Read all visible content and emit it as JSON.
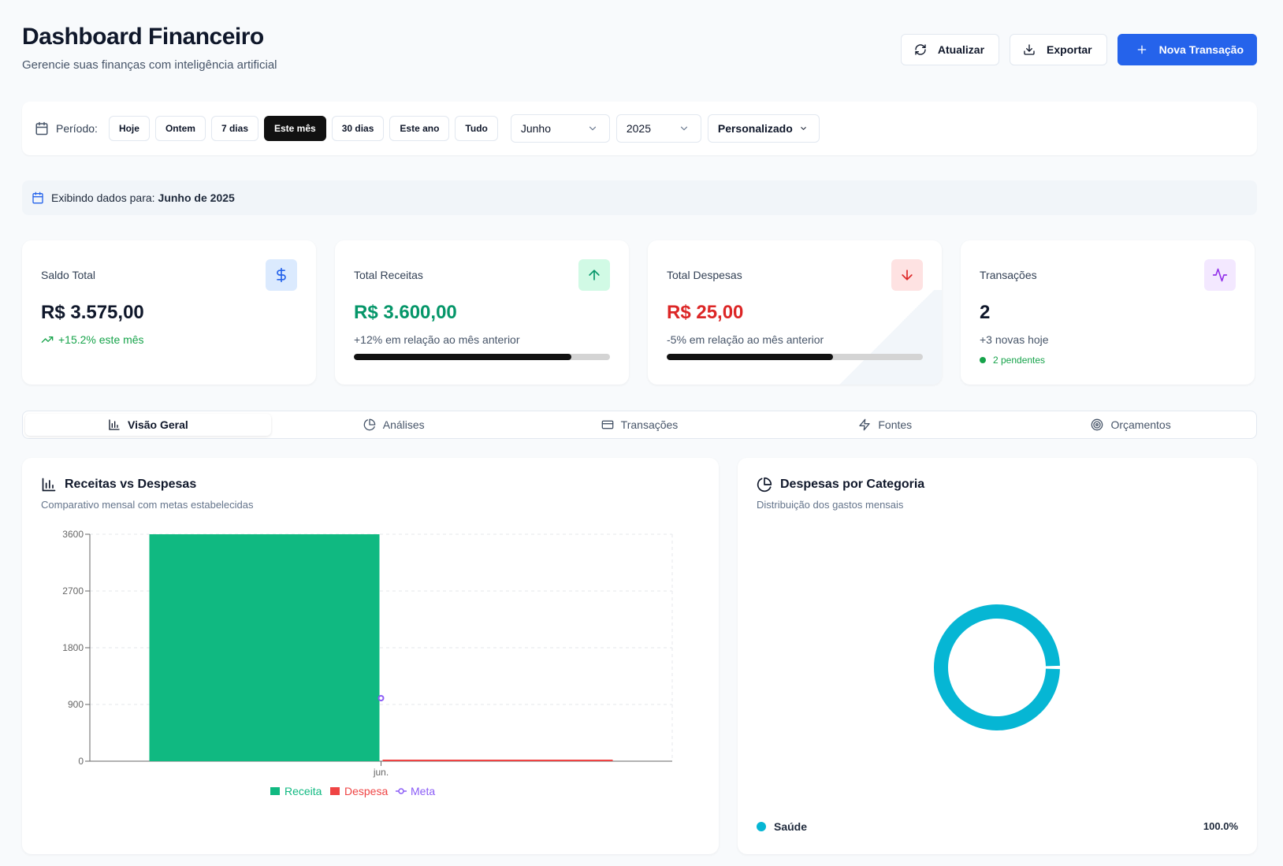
{
  "header": {
    "title": "Dashboard Financeiro",
    "subtitle": "Gerencie suas finanças com inteligência artificial",
    "refresh_label": "Atualizar",
    "export_label": "Exportar",
    "new_label": "Nova Transação"
  },
  "period": {
    "label": "Período:",
    "chips": [
      "Hoje",
      "Ontem",
      "7 dias",
      "Este mês",
      "30 dias",
      "Este ano",
      "Tudo"
    ],
    "active_chip": "Este mês",
    "month": "Junho",
    "year": "2025",
    "custom": "Personalizado"
  },
  "info": {
    "prefix": "Exibindo dados para:",
    "value": "Junho de 2025"
  },
  "cards": [
    {
      "title": "Saldo Total",
      "value": "R$ 3.575,00",
      "sub": "+15.2% este mês",
      "icon": "dollar-icon"
    },
    {
      "title": "Total Receitas",
      "value": "R$ 3.600,00",
      "sub": "+12% em relação ao mês anterior",
      "progress": 0.85,
      "icon": "arrow-up-icon"
    },
    {
      "title": "Total Despesas",
      "value": "R$ 25,00",
      "sub": "-5% em relação ao mês anterior",
      "progress": 0.65,
      "icon": "arrow-down-icon"
    },
    {
      "title": "Transações",
      "value": "2",
      "sub": "+3 novas hoje",
      "pending": "2 pendentes",
      "icon": "activity-icon"
    }
  ],
  "tabs": [
    "Visão Geral",
    "Análises",
    "Transações",
    "Fontes",
    "Orçamentos"
  ],
  "revenue_panel": {
    "title": "Receitas vs Despesas",
    "subtitle": "Comparativo mensal com metas estabelecidas"
  },
  "category_panel": {
    "title": "Despesas por Categoria",
    "subtitle": "Distribuição dos gastos mensais",
    "legend_label": "Saúde",
    "legend_pct": "100.0%"
  },
  "colors": {
    "primary": "#2563eb",
    "receita": "#10b981",
    "despesa": "#ef4444",
    "meta": "#8b5cf6",
    "saude": "#06b6d4"
  },
  "chart_data": [
    {
      "type": "bar",
      "title": "Receitas vs Despesas",
      "categories": [
        "jun."
      ],
      "series": [
        {
          "name": "Receita",
          "values": [
            3600
          ]
        },
        {
          "name": "Despesa",
          "values": [
            25
          ]
        },
        {
          "name": "Meta",
          "values": [
            1000
          ]
        }
      ],
      "yticks": [
        "0",
        "900",
        "1800",
        "2700",
        "3600"
      ],
      "ylim": [
        0,
        3600
      ],
      "grid": true,
      "legend": "bottom"
    },
    {
      "type": "pie",
      "title": "Despesas por Categoria",
      "labels": [
        "Saúde"
      ],
      "values": [
        100.0
      ],
      "legend": "bottom"
    }
  ]
}
